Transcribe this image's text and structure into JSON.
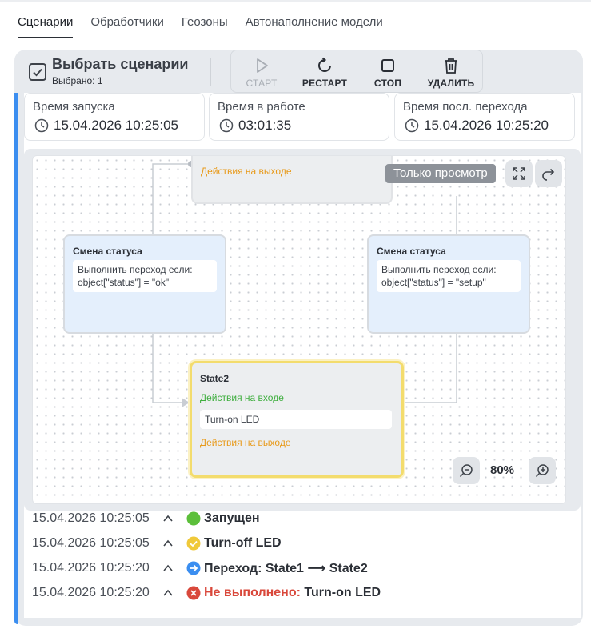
{
  "tabs": [
    {
      "label": "Сценарии",
      "active": true
    },
    {
      "label": "Обработчики",
      "active": false
    },
    {
      "label": "Геозоны",
      "active": false
    },
    {
      "label": "Автонаполнение модели",
      "active": false
    }
  ],
  "header": {
    "title": "Выбрать сценарии",
    "selected": "Выбрано: 1"
  },
  "toolbar": {
    "start": "СТАРТ",
    "restart": "РЕСТАРТ",
    "stop": "СТОП",
    "delete": "УДАЛИТЬ"
  },
  "stats": [
    {
      "label": "Время запуска",
      "value": "15.04.2026 10:25:05"
    },
    {
      "label": "Время в работе",
      "value": "03:01:35"
    },
    {
      "label": "Время посл. перехода",
      "value": "15.04.2026 10:25:20"
    }
  ],
  "canvas": {
    "readonly_label": "Только просмотр",
    "zoom": "80%",
    "top_node": {
      "exit_label": "Действия на выходе"
    },
    "left_node": {
      "title": "Смена статуса",
      "condition": "Выполнить переход если: object[\"status\"] = \"ok\""
    },
    "right_node": {
      "title": "Смена статуса",
      "condition": "Выполнить переход если: object[\"status\"] = \"setup\""
    },
    "state_node": {
      "title": "State2",
      "enter_label": "Действия на входе",
      "enter_action": "Turn-on LED",
      "exit_label": "Действия на выходе"
    }
  },
  "log": [
    {
      "time": "15.04.2026 10:25:05",
      "status": "green",
      "text": "Запущен",
      "prefix": ""
    },
    {
      "time": "15.04.2026 10:25:05",
      "status": "yellow-check",
      "text": "Turn-off LED",
      "prefix": ""
    },
    {
      "time": "15.04.2026 10:25:20",
      "status": "blue-arrow",
      "text": "Переход: State1 ⟶ State2",
      "prefix": ""
    },
    {
      "time": "15.04.2026 10:25:20",
      "status": "red-x",
      "text": " Turn-on LED",
      "prefix": "Не выполнено:"
    }
  ],
  "colors": {
    "accent": "#3b8ef0",
    "success": "#5cbf3a",
    "warning": "#f0c93a",
    "error": "#d9483b",
    "exit_action": "#e89a1a",
    "enter_action": "#3fae3f"
  }
}
